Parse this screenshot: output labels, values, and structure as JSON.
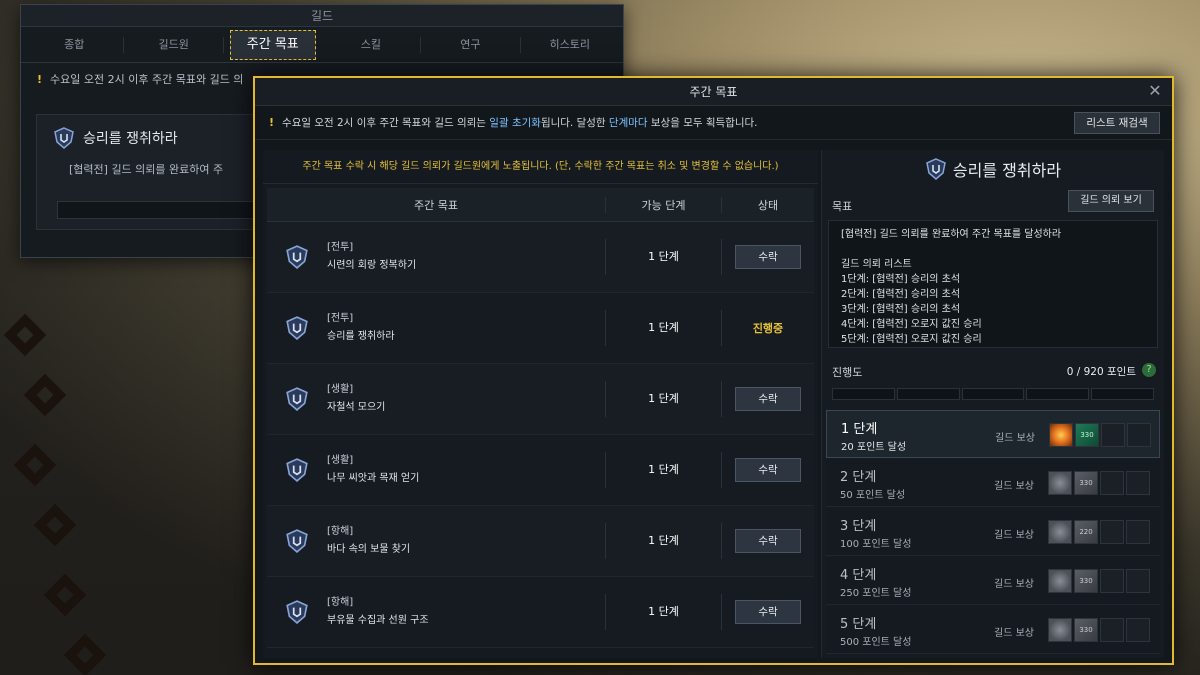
{
  "back_window": {
    "title": "길드",
    "tabs": [
      "종합",
      "길드원",
      "주간 목표",
      "스킬",
      "연구",
      "히스토리"
    ],
    "active_tab_index": 2,
    "notice": "수요일 오전 2시 이후 주간 목표와 길드 의",
    "card_title": "승리를 쟁취하라",
    "card_desc": "[협력전] 길드 의뢰를 완료하여 주"
  },
  "window": {
    "title": "주간 목표",
    "close_icon": "close-icon"
  },
  "notice": {
    "part1": "수요일 오전 2시 ",
    "part2": "이후 주간 목표와 길드 의뢰는 ",
    "part3": "일괄 초기화",
    "part4": "됩니다. 달성한 ",
    "part5": "단계마다",
    "part6": " 보상을 모두 획득합니다."
  },
  "reload_button": "리스트 재검색",
  "accept_note": "주간 목표 수락 시 해당 길드 의뢰가 길드원에게 노출됩니다. (단, 수락한 주간 목표는 취소 및 변경할 수 없습니다.)",
  "table": {
    "headers": {
      "goal": "주간 목표",
      "stage": "가능 단계",
      "status": "상태"
    },
    "rows": [
      {
        "category": "[전투]",
        "name": "시련의 회랑 정복하기",
        "stage": "1 단계",
        "status": "수락",
        "state": "button"
      },
      {
        "category": "[전투]",
        "name": "승리를 쟁취하라",
        "stage": "1 단계",
        "status": "진행중",
        "state": "progress"
      },
      {
        "category": "[생활]",
        "name": "자철석 모으기",
        "stage": "1 단계",
        "status": "수락",
        "state": "button"
      },
      {
        "category": "[생활]",
        "name": "나무 씨앗과 목재 얻기",
        "stage": "1 단계",
        "status": "수락",
        "state": "button"
      },
      {
        "category": "[항해]",
        "name": "바다 속의 보물 찾기",
        "stage": "1 단계",
        "status": "수락",
        "state": "button"
      },
      {
        "category": "[항해]",
        "name": "부유물 수집과 선원 구조",
        "stage": "1 단계",
        "status": "수락",
        "state": "button"
      }
    ]
  },
  "detail": {
    "title": "승리를 쟁취하라",
    "goal_label": "목표",
    "guild_quest_button": "길드 의뢰 보기",
    "goal_text": "[협력전] 길드 의뢰를 완료하여 주간 목표를 달성하라",
    "quest_list_title": "길드 의뢰 리스트",
    "quest_list": [
      "1단계: [협력전] 승리의 초석",
      "2단계: [협력전] 승리의 초석",
      "3단계: [협력전] 승리의 초석",
      "4단계: [협력전] 오로지 값진 승리",
      "5단계: [협력전] 오로지 값진 승리"
    ],
    "progress_label": "진행도",
    "progress_value": "0 / 920 포인트",
    "progress_fraction": 0,
    "help_icon": "?",
    "stages": [
      {
        "name": "1 단계",
        "sub": "20 포인트 달성",
        "reward_label": "길드 보상",
        "r1": "3200",
        "r2": "길드 EXP",
        "r2_val": "330",
        "active": true
      },
      {
        "name": "2 단계",
        "sub": "50 포인트 달성",
        "reward_label": "길드 보상",
        "r1": "3200",
        "r2": "길드 EXP",
        "r2_val": "330",
        "active": false
      },
      {
        "name": "3 단계",
        "sub": "100 포인트 달성",
        "reward_label": "길드 보상",
        "r1": "3200",
        "r2": "길드 EXP",
        "r2_val": "220",
        "active": false
      },
      {
        "name": "4 단계",
        "sub": "250 포인트 달성",
        "reward_label": "길드 보상",
        "r1": "3200",
        "r2": "길드 EXP",
        "r2_val": "330",
        "active": false
      },
      {
        "name": "5 단계",
        "sub": "500 포인트 달성",
        "reward_label": "길드 보상",
        "r1": "3200",
        "r2": "길드 EXP",
        "r2_val": "330",
        "active": false
      }
    ]
  },
  "colors": {
    "accent": "#e3b92b",
    "highlight": "#7fc3ff",
    "in_progress": "#e6c23a"
  }
}
